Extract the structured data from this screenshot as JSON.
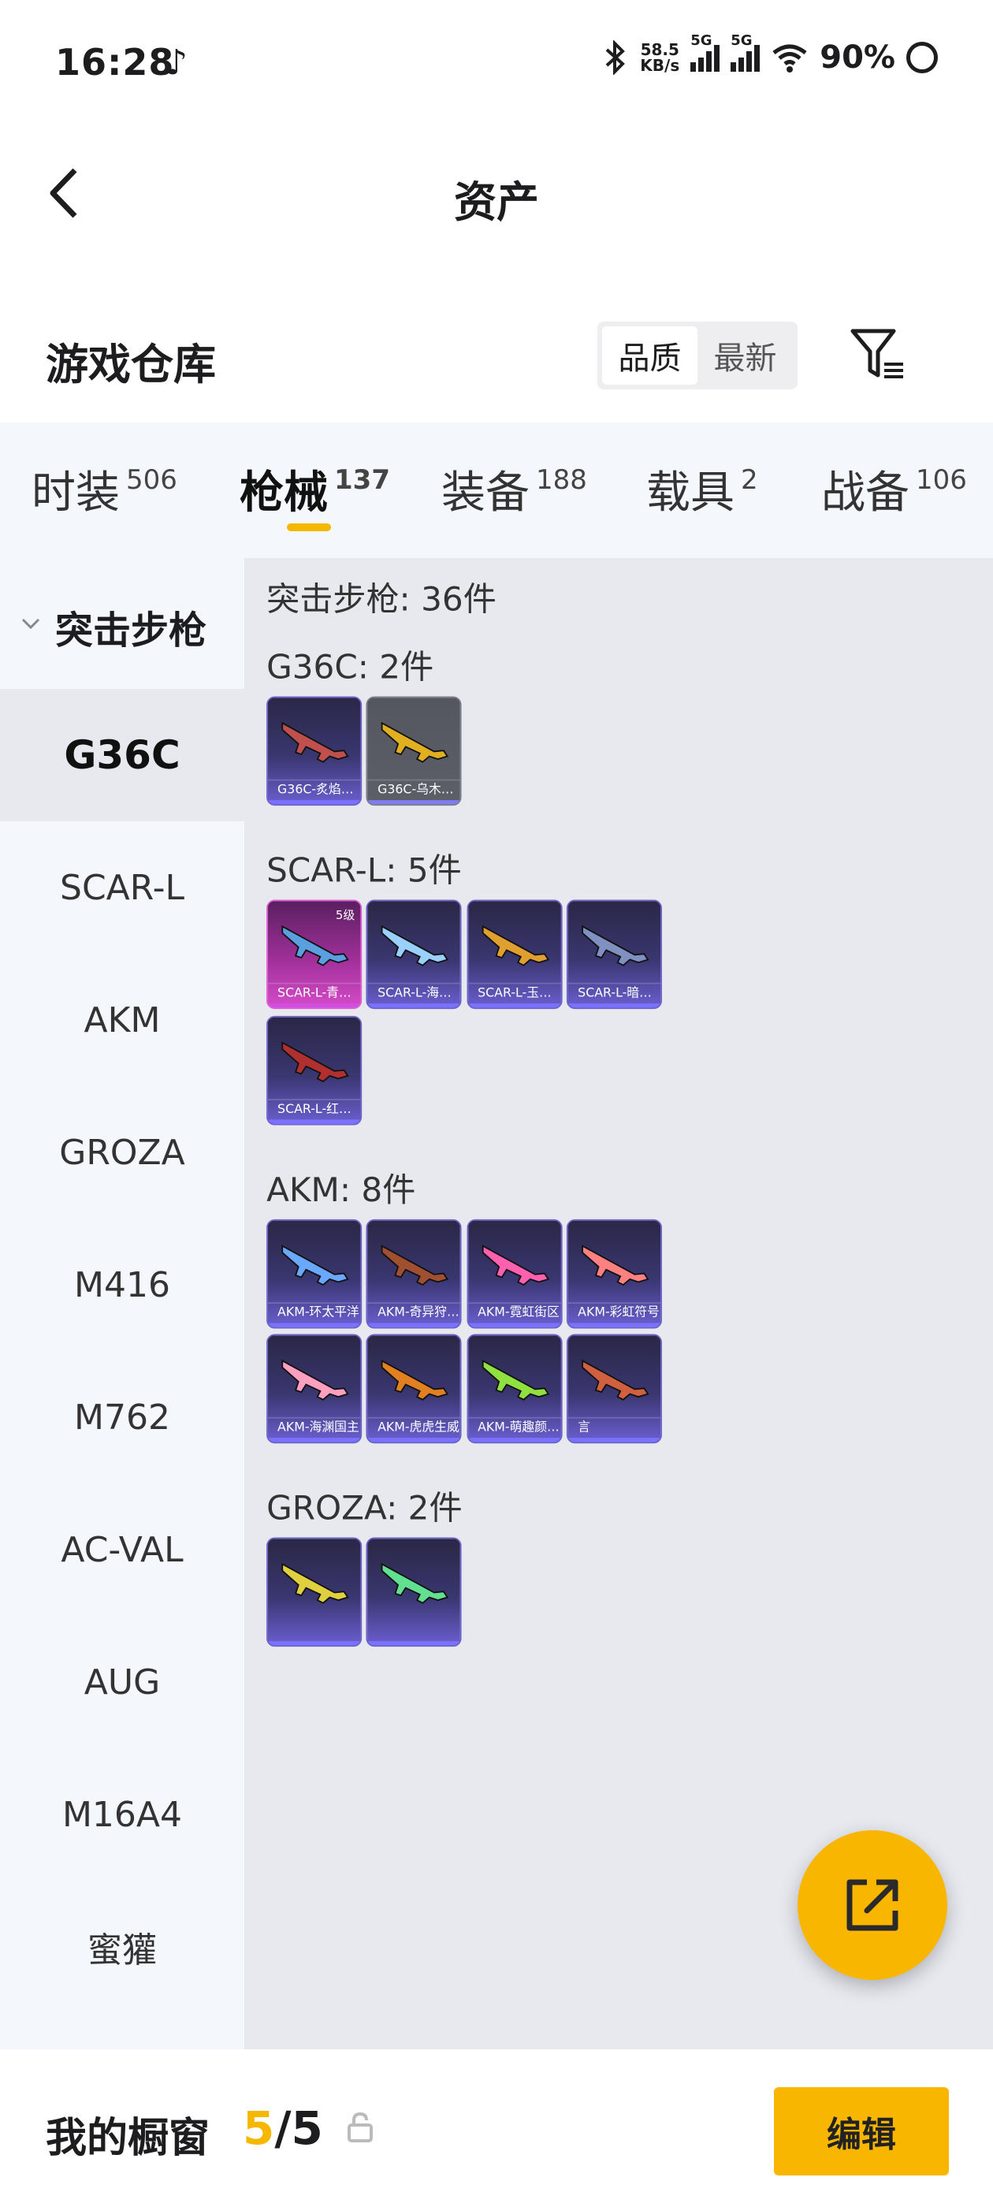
{
  "status_bar": {
    "time": "16:28",
    "net_speed_value": "58.5",
    "net_speed_unit": "KB/s",
    "sim1": "5G",
    "sim2": "5G",
    "battery": "90%"
  },
  "header": {
    "title": "资产"
  },
  "warehouse": {
    "title": "游戏仓库",
    "sort_options": [
      "品质",
      "最新"
    ],
    "active_sort": "品质"
  },
  "tabs": [
    {
      "label": "时装",
      "count": "506"
    },
    {
      "label": "枪械",
      "count": "137",
      "active": true
    },
    {
      "label": "装备",
      "count": "188"
    },
    {
      "label": "载具",
      "count": "2"
    },
    {
      "label": "战备",
      "count": "106"
    }
  ],
  "sidebar": {
    "category": "突击步枪",
    "items": [
      "G36C",
      "SCAR-L",
      "AKM",
      "GROZA",
      "M416",
      "M762",
      "AC-VAL",
      "AUG",
      "M16A4",
      "蜜獾"
    ],
    "active": "G36C"
  },
  "main": {
    "summary": "突击步枪: 36件",
    "groups": [
      {
        "title": "G36C: 2件",
        "items": [
          {
            "name": "G36C-炙焰…",
            "style": "purple"
          },
          {
            "name": "G36C-乌木…",
            "style": "gray"
          }
        ]
      },
      {
        "title": "SCAR-L: 5件",
        "items": [
          {
            "name": "SCAR-L-青…",
            "style": "pink",
            "level": "5级"
          },
          {
            "name": "SCAR-L-海…",
            "style": "purple"
          },
          {
            "name": "SCAR-L-玉…",
            "style": "purple"
          },
          {
            "name": "SCAR-L-暗…",
            "style": "purple"
          },
          {
            "name": "SCAR-L-红…",
            "style": "purple"
          }
        ]
      },
      {
        "title": "AKM: 8件",
        "items": [
          {
            "name": "AKM-环太平洋",
            "style": "purple"
          },
          {
            "name": "AKM-奇异狩…",
            "style": "purple"
          },
          {
            "name": "AKM-霓虹街区",
            "style": "purple"
          },
          {
            "name": "AKM-彩虹符号",
            "style": "purple"
          },
          {
            "name": "AKM-海渊国主",
            "style": "purple"
          },
          {
            "name": "AKM-虎虎生威",
            "style": "purple"
          },
          {
            "name": "AKM-萌趣颜…",
            "style": "purple"
          },
          {
            "name": "言",
            "style": "purple"
          }
        ]
      },
      {
        "title": "GROZA: 2件",
        "items": [
          {
            "name": "",
            "style": "purple"
          },
          {
            "name": "",
            "style": "purple"
          }
        ]
      }
    ]
  },
  "bottom_bar": {
    "label": "我的橱窗",
    "current": "5",
    "total": "/5",
    "edit_label": "编辑"
  },
  "colors": {
    "accent": "#f9b600",
    "card_purple": "#3a3670",
    "card_pink": "#a0309a"
  }
}
